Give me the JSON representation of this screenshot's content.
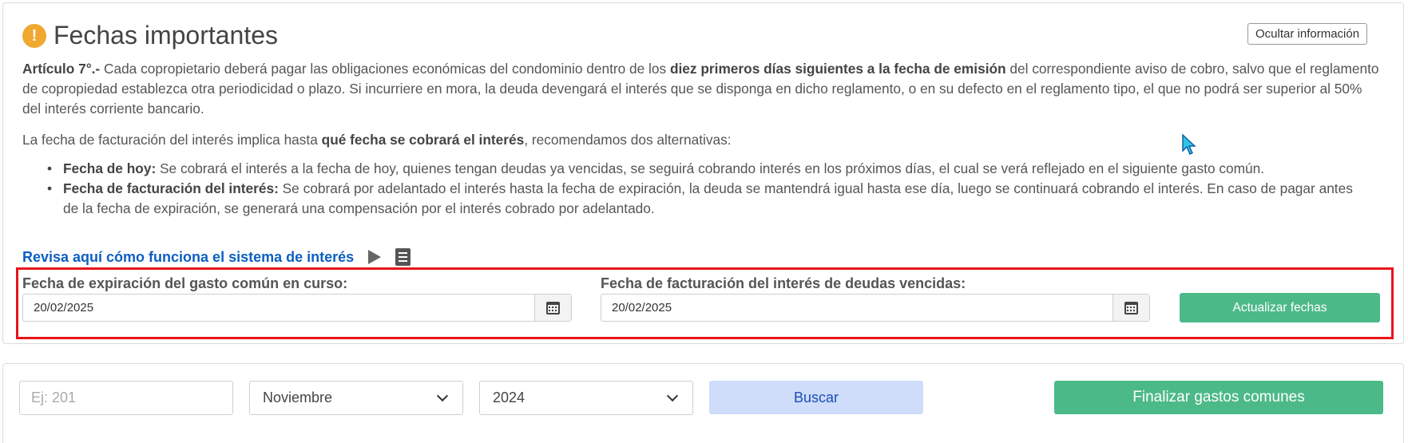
{
  "info": {
    "title": "Fechas importantes",
    "warning_symbol": "!",
    "hide_button": "Ocultar información",
    "p1_bold1": "Artículo 7°.-",
    "p1_text1": " Cada copropietario deberá pagar las obligaciones económicas del condominio dentro de los ",
    "p1_bold2": "diez primeros días siguientes a la fecha de emisión",
    "p1_text2": " del correspondiente aviso de cobro, salvo que el reglamento de copropiedad establezca otra periodicidad o plazo. Si incurriere en mora, la deuda devengará el interés que se disponga en dicho reglamento, o en su defecto en el reglamento tipo, el que no podrá ser superior al 50% del interés corriente bancario.",
    "p2_text1": "La fecha de facturación del interés implica hasta ",
    "p2_bold": "qué fecha se cobrará el interés",
    "p2_text2": ", recomendamos dos alternativas:",
    "bullets": [
      {
        "bold": "Fecha de hoy:",
        "text": " Se cobrará el interés a la fecha de hoy, quienes tengan deudas ya vencidas, se seguirá cobrando interés en los próximos días, el cual se verá reflejado en el siguiente gasto común."
      },
      {
        "bold": "Fecha de facturación del interés:",
        "text": " Se cobrará por adelantado el interés hasta la fecha de expiración, la deuda se mantendrá igual hasta ese día, luego se continuará cobrando el interés. En caso de pagar antes de la fecha de expiración, se generará una compensación por el interés cobrado por adelantado."
      }
    ],
    "help_link": "Revisa aquí cómo funciona el sistema de interés"
  },
  "dates": {
    "expiration_label": "Fecha de expiración del gasto común en curso:",
    "expiration_value": "20/02/2025",
    "billing_label": "Fecha de facturación del interés de deudas vencidas:",
    "billing_value": "20/02/2025",
    "update_button": "Actualizar fechas"
  },
  "filters": {
    "search_placeholder": "Ej: 201",
    "month": "Noviembre",
    "year": "2024",
    "search_button": "Buscar",
    "finish_button": "Finalizar gastos comunes"
  },
  "colors": {
    "accent_green": "#4cb988",
    "link_blue": "#0d5fc2",
    "highlight_red": "#e8141b",
    "warning_orange": "#f0a830",
    "search_button_bg": "#cfdcfa"
  },
  "icons": [
    "warning-icon",
    "play-icon",
    "book-icon",
    "calendar-icon",
    "chevron-down-icon"
  ]
}
